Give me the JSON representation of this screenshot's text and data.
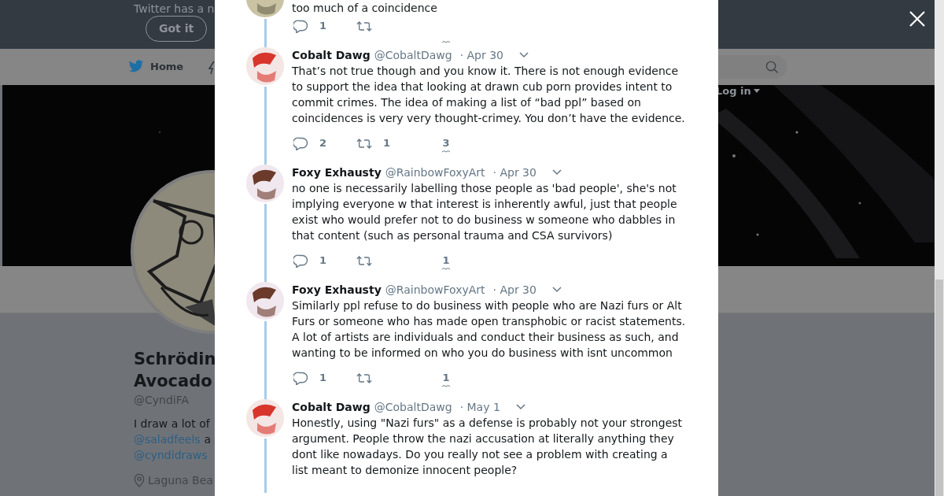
{
  "banner": {
    "text": "Twitter has a n",
    "button": "Got it"
  },
  "nav": {
    "home": "Home",
    "login": "Log in"
  },
  "profile": {
    "name_lines": [
      "Schrödin",
      "Avocado"
    ],
    "handle": "@CyndiFA",
    "bio_lines": [
      [
        {
          "kind": "text",
          "text": "I draw a lot of"
        }
      ],
      [
        {
          "kind": "link",
          "text": "@saladfeels"
        },
        {
          "kind": "text",
          "text": "a"
        }
      ],
      [
        {
          "kind": "link",
          "text": "@cyndidraws"
        }
      ]
    ],
    "location": "Laguna Bea"
  },
  "thread": [
    {
      "partial": true,
      "text": "too much of a coincidence",
      "replies": "1"
    },
    {
      "partial": false,
      "name": "Cobalt Dawg",
      "handle": "@CobaltDawg",
      "date": "· Apr 30",
      "text": "That’s not true though and you know it. There is not enough evidence to support the idea that looking at drawn cub porn provides intent to commit crimes. The idea of making a list of “bad ppl” based on coincidences is very very thought-crimey. You don’t have the evidence.",
      "replies": "2",
      "retweets": "1",
      "likes": "3"
    },
    {
      "partial": false,
      "name": "Foxy Exhausty",
      "handle": "@RainbowFoxyArt",
      "date": "· Apr 30",
      "text": "no one is necessarily labelling those people as 'bad people', she's not implying everyone w that interest is inherently awful, just that people exist who would prefer not to do business w someone who dabbles in that content (such as personal trauma and CSA survivors)",
      "replies": "1",
      "likes": "1"
    },
    {
      "partial": false,
      "name": "Foxy Exhausty",
      "handle": "@RainbowFoxyArt",
      "date": "· Apr 30",
      "text": "Similarly ppl refuse to do business with people who are Nazi furs or Alt Furs or someone who has made open transphobic or racist statements. A lot of artists are individuals and conduct their business as such, and wanting to be informed on who you do business with isnt uncommon",
      "replies": "1",
      "likes": "1"
    },
    {
      "partial": false,
      "name": "Cobalt Dawg",
      "handle": "@CobaltDawg",
      "date": "· May 1",
      "text": "Honestly, using \"Nazi furs\" as a defense is probably not your strongest argument. People throw the nazi accusation at literally anything they dont like nowadays. Do you really not see a problem with creating a list meant to demonize innocent people?"
    }
  ]
}
